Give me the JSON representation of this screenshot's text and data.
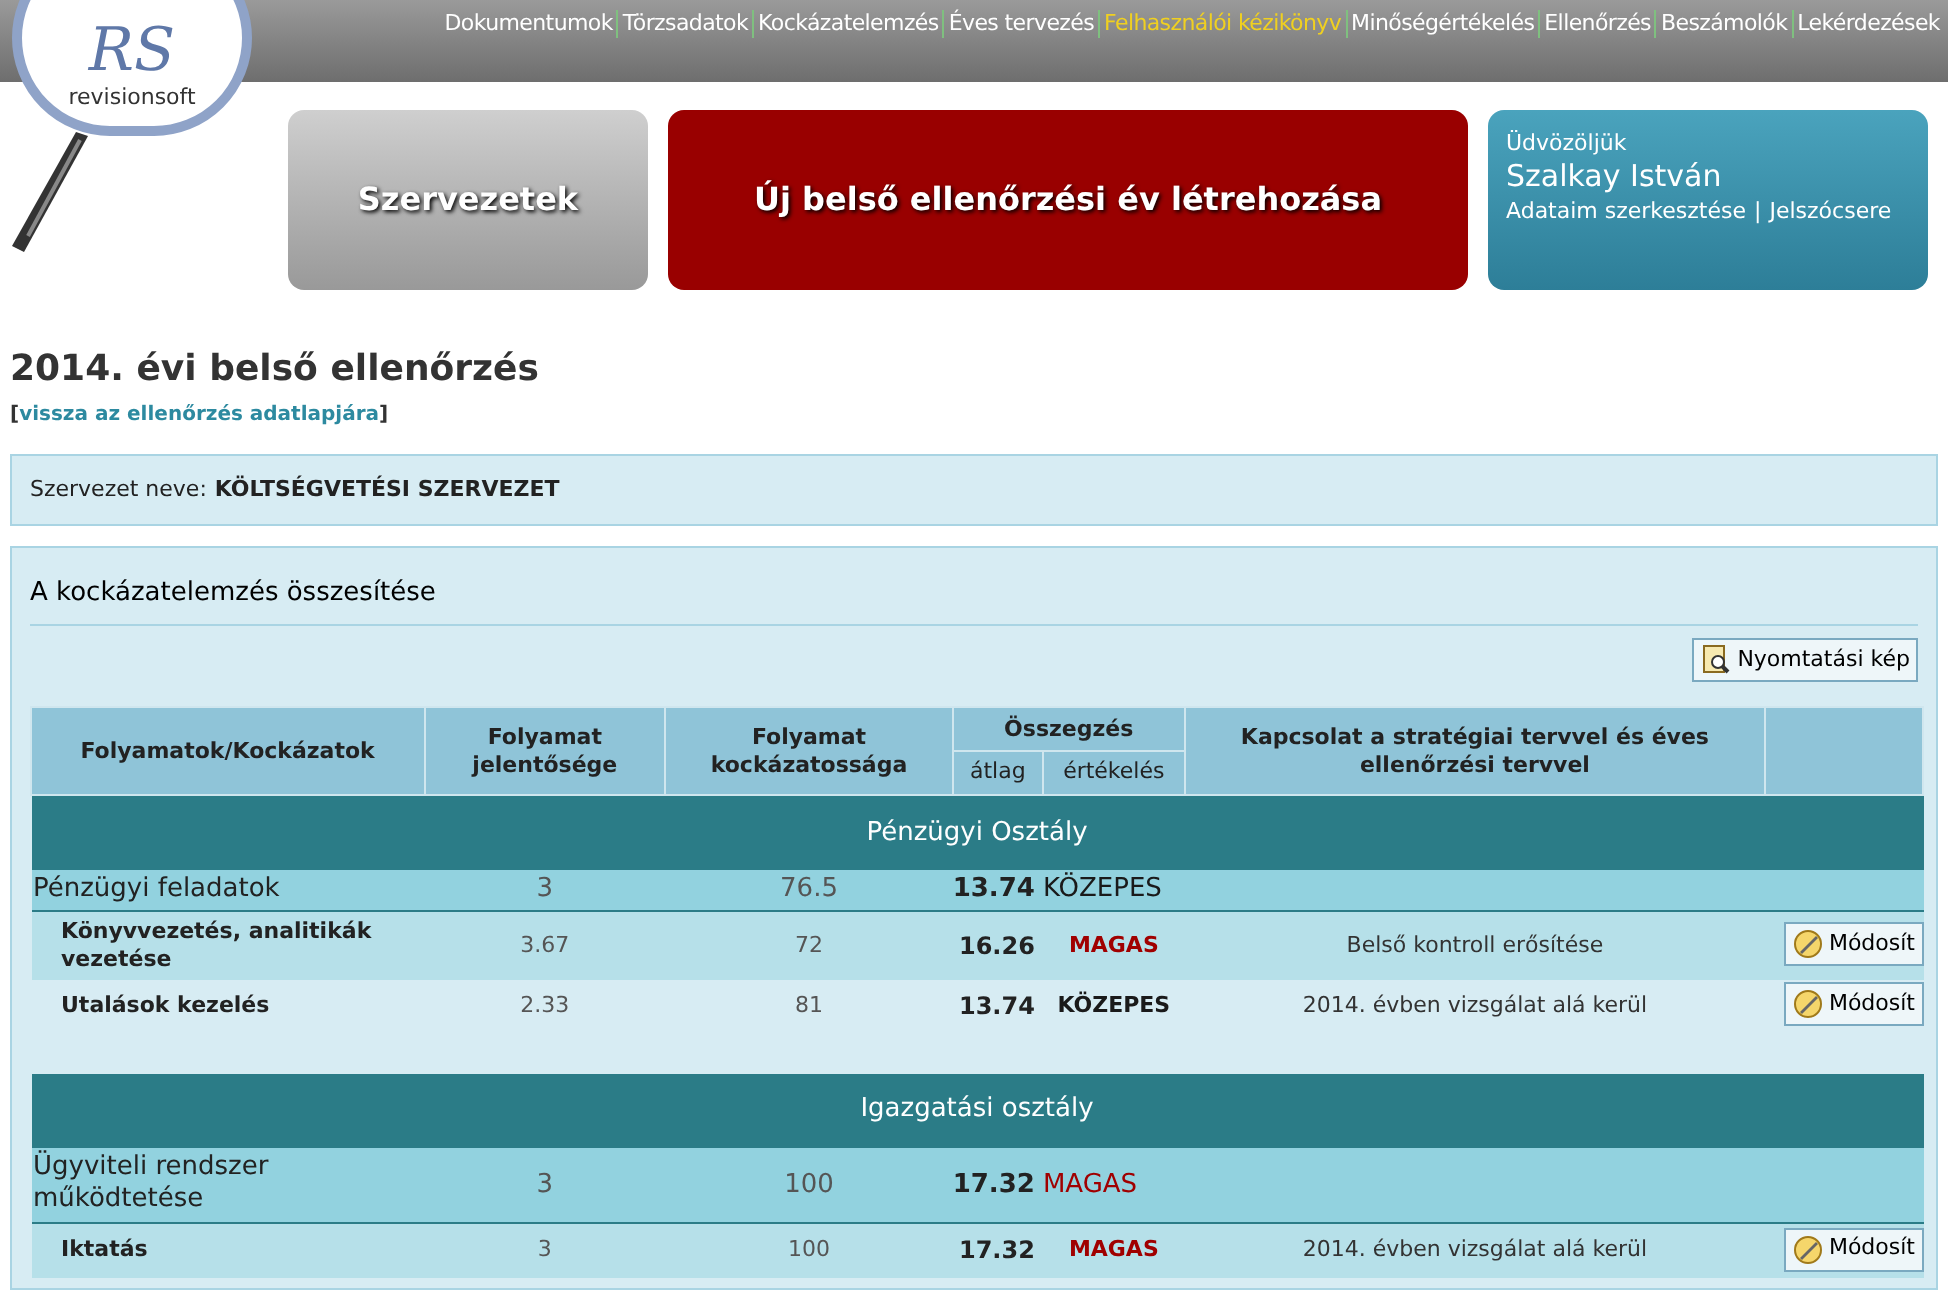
{
  "logo": {
    "mark": "RS",
    "text": "revisionsoft"
  },
  "menu": [
    {
      "label": "Dokumentumok",
      "selected": false
    },
    {
      "label": "Törzsadatok",
      "selected": false
    },
    {
      "label": "Kockázatelemzés",
      "selected": false
    },
    {
      "label": "Éves tervezés",
      "selected": false
    },
    {
      "label": "Felhasználói kézikönyv",
      "selected": true
    },
    {
      "label": "Minőségértékelés",
      "selected": false
    },
    {
      "label": "Ellenőrzés",
      "selected": false
    },
    {
      "label": "Beszámolók",
      "selected": false
    },
    {
      "label": "Lekérdezések",
      "selected": false
    }
  ],
  "tiles": [
    {
      "kind": "gray",
      "label": "Szervezetek"
    },
    {
      "kind": "red",
      "label": "Új belső ellenőrzési év létrehozása"
    }
  ],
  "user_box": {
    "greeting": "Üdvözöljük",
    "name": "Szalkay István",
    "links": [
      "Adataim szerkesztése",
      "Jelszócsere"
    ],
    "separator": "|"
  },
  "page_title": "2014. évi belső ellenőrzés",
  "back_link": {
    "open": "[",
    "label": "vissza az ellenőrzés adatlapjára",
    "close": "]"
  },
  "organization": {
    "label": "Szervezet neve:",
    "value": "KÖLTSÉGVETÉSI SZERVEZET"
  },
  "summary": {
    "title": "A kockázatelemzés összesítése",
    "print_button": "Nyomtatási kép",
    "columns": {
      "name": "Folyamatok/Kockázatok",
      "significance": "Folyamat jelentősége",
      "riskiness": "Folyamat kockázatossága",
      "summary": "Összegzés",
      "average": "átlag",
      "rating": "értékelés",
      "link": "Kapcsolat a stratégiai tervvel és éves ellenőrzési tervvel"
    },
    "groups": [
      {
        "name": "Pénzügyi Osztály",
        "processes": [
          {
            "name": "Pénzügyi feladatok",
            "significance": "3",
            "riskiness": "76.5",
            "average": "13.74",
            "rating": "KÖZEPES",
            "color": "#1a1a1a",
            "children": [
              {
                "name": "Könyvvezetés, analitikák vezetése",
                "significance": "3.67",
                "riskiness": "72",
                "average": "16.26",
                "rating": "MAGAS",
                "color": "#a00000",
                "link": "Belső kontroll erősítése",
                "button": "Módosít"
              },
              {
                "name": "Utalások kezelés",
                "significance": "2.33",
                "riskiness": "81",
                "average": "13.74",
                "rating": "KÖZEPES",
                "color": "#1a1a1a",
                "link": "2014. évben vizsgálat alá kerül",
                "button": "Módosít"
              }
            ]
          }
        ]
      },
      {
        "name": "Igazgatási osztály",
        "processes": [
          {
            "name": "Ügyviteli rendszer működtetése",
            "significance": "3",
            "riskiness": "100",
            "average": "17.32",
            "rating": "MAGAS",
            "color": "#a00000",
            "children": [
              {
                "name": "Iktatás",
                "significance": "3",
                "riskiness": "100",
                "average": "17.32",
                "rating": "MAGAS",
                "color": "#a00000",
                "link": "2014. évben vizsgálat alá kerül",
                "button": "Módosít"
              }
            ]
          }
        ]
      }
    ]
  }
}
